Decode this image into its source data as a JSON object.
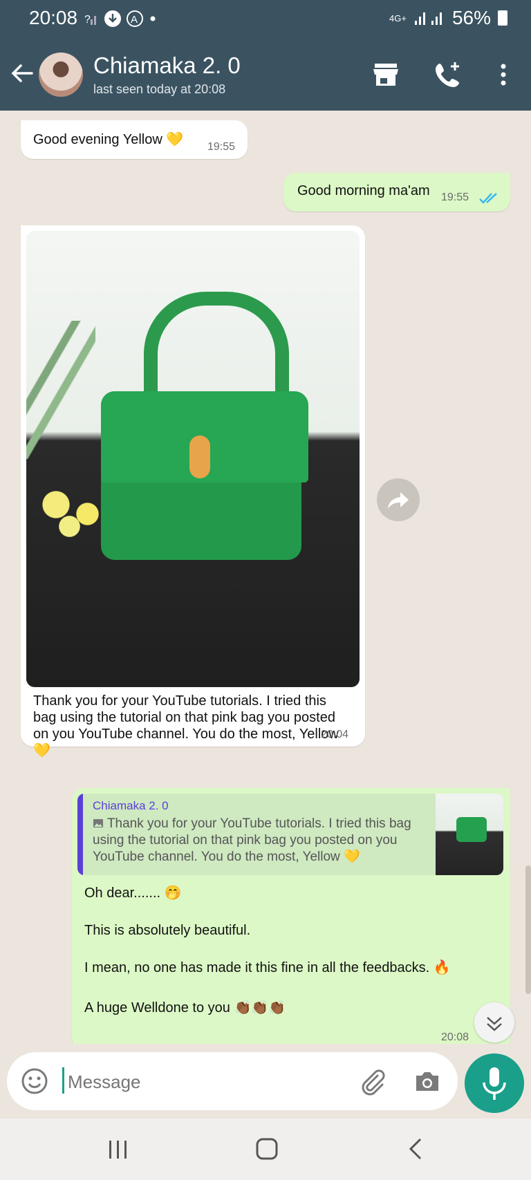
{
  "status_bar": {
    "time": "20:08",
    "left_icons": [
      "signal-question-icon",
      "download-icon",
      "auto-a-icon",
      "dot-icon"
    ],
    "network": "4G+",
    "battery": "56%"
  },
  "header": {
    "contact_name": "Chiamaka 2. 0",
    "contact_status": "last seen today at 20:08",
    "icons": [
      "back-arrow-icon",
      "store-icon",
      "add-call-icon",
      "more-vert-icon"
    ]
  },
  "messages": [
    {
      "direction": "in",
      "text": "Good evening Yellow 💛",
      "time": "19:55"
    },
    {
      "direction": "out",
      "text": "Good morning ma'am",
      "time": "19:55",
      "status": "read"
    },
    {
      "direction": "in",
      "type": "image",
      "caption": "Thank you for your YouTube tutorials. I tried this bag using the tutorial on that pink bag you posted on you YouTube channel. You do the most, Yellow 💛",
      "time": "20:04"
    },
    {
      "direction": "out",
      "type": "reply",
      "quote_author": "Chiamaka 2. 0",
      "quote_text": "Thank you for your YouTube tutorials. I tried this bag using the tutorial on that pink bag you posted on you YouTube channel. You do the most, Yellow 💛",
      "lines": [
        "Oh dear....... 🤭",
        "This is absolutely beautiful.",
        "I mean, no one has made it this fine in all the feedbacks. 🔥",
        "A huge Welldone to you 👏🏾👏🏾👏🏾"
      ],
      "time": "20:08"
    }
  ],
  "compose": {
    "placeholder": "Message"
  },
  "colors": {
    "header": "#3b5361",
    "outgoing": "#dcf8c6",
    "accent": "#1a9f8a",
    "read_ticks": "#34b7f1"
  }
}
